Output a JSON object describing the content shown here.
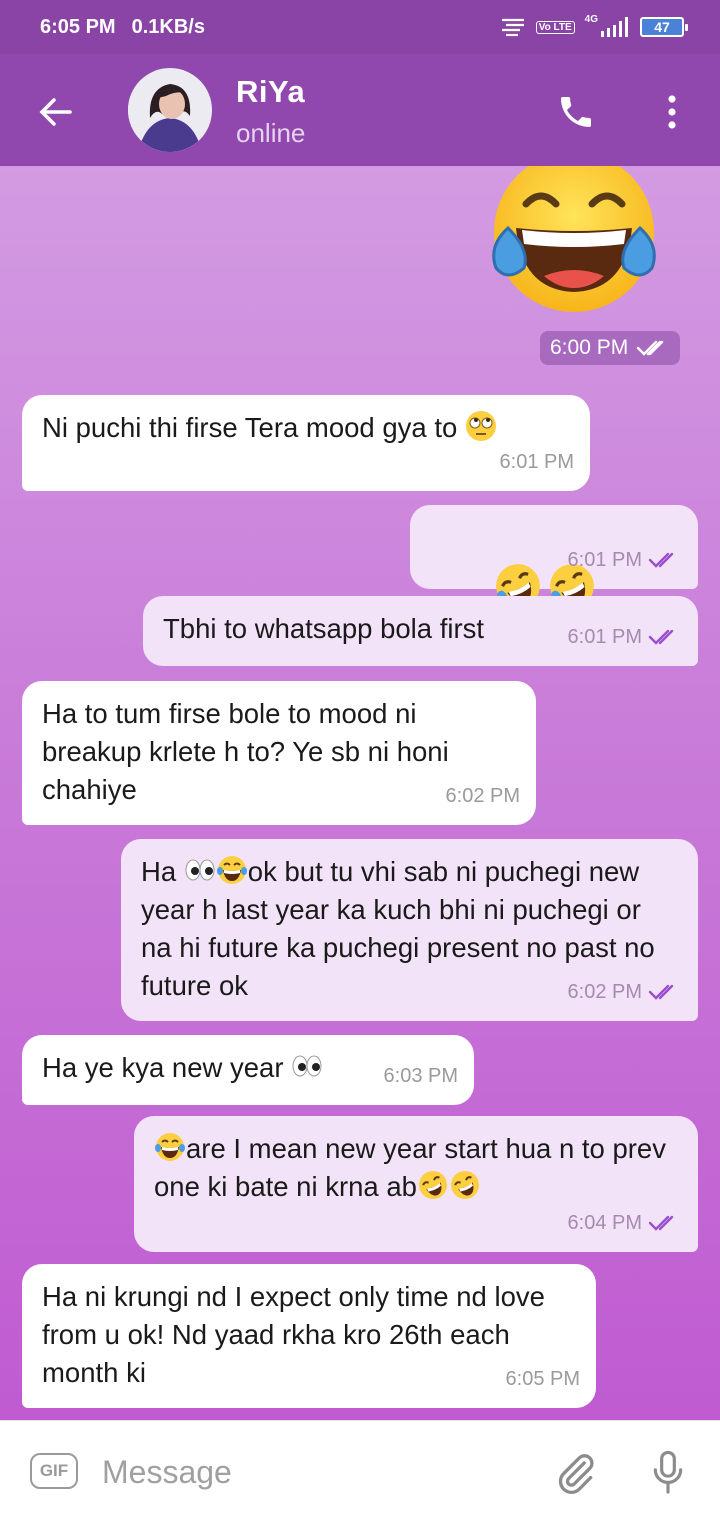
{
  "status_bar": {
    "time": "6:05 PM",
    "speed": "0.1KB/s",
    "volte": "Vo LTE",
    "network": "4G",
    "battery": "47"
  },
  "header": {
    "contact_name": "RiYa",
    "contact_status": "online"
  },
  "chat": {
    "sticker_time": "6:00 PM",
    "messages": [
      {
        "dir": "in",
        "text": "Ni puchi thi firse Tera mood gya to",
        "time": "6:01 PM"
      },
      {
        "dir": "out",
        "text": "",
        "time": "6:01 PM"
      },
      {
        "dir": "out",
        "text": "Tbhi to whatsapp bola first",
        "time": "6:01 PM"
      },
      {
        "dir": "in",
        "text": "Ha to tum firse bole to mood ni breakup krlete h to? Ye sb ni honi chahiye",
        "time": "6:02 PM"
      },
      {
        "dir": "out",
        "text_a": "Ha ",
        "text_b": "ok but tu vhi sab ni puchegi new year h last year ka kuch bhi ni puchegi or na hi future ka puchegi present no past no future ok",
        "time": "6:02 PM"
      },
      {
        "dir": "in",
        "text": "Ha ye kya new year ",
        "time": "6:03 PM"
      },
      {
        "dir": "out",
        "text": "are I mean new year start hua n to prev one ki bate ni krna ab",
        "time": "6:04 PM"
      },
      {
        "dir": "in",
        "text": "Ha ni krungi nd I expect only time nd love from u ok! Nd yaad rkha kro 26th each month ki",
        "time": "6:05 PM"
      }
    ]
  },
  "input": {
    "gif_label": "GIF",
    "placeholder": "Message"
  },
  "colors": {
    "header": "#9048ae",
    "statusbar": "#8a44a6",
    "incoming_bubble": "#ffffff",
    "outgoing_bubble": "#f3e3f8",
    "read_tick": "#9b4fd0"
  }
}
